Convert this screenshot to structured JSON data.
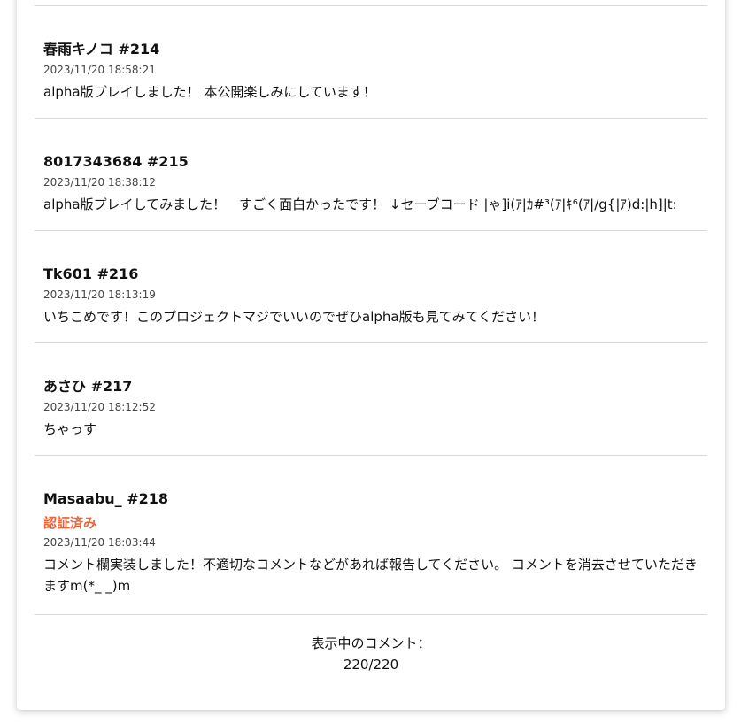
{
  "comments": [
    {
      "author": "春雨キノコ #214",
      "date": "2023/11/20 18:58:21",
      "body": "alpha版プレイしました！ 本公開楽しみにしています！"
    },
    {
      "author": "8017343684 #215",
      "date": "2023/11/20 18:38:12",
      "body": "alpha版プレイしてみました！　すごく面白かったです！ ↓セーブコード |ゃ]i(ｱ|ｶ#³(ｱ|ｷ⁶(ｱ|/g{|ｱ)d:|h]|t:"
    },
    {
      "author": "Tk601 #216",
      "date": "2023/11/20 18:13:19",
      "body": "いちこめです！このプロジェクトマジでいいのでぜひalpha版も見てみてください！"
    },
    {
      "author": "あさひ #217",
      "date": "2023/11/20 18:12:52",
      "body": "ちゃっす"
    },
    {
      "author": "Masaabu_ #218",
      "badge": "認証済み",
      "date": "2023/11/20 18:03:44",
      "body": "コメント欄実装しました！不適切なコメントなどがあれば報告してください。 コメントを消去させていただきますm(*_ _)m"
    }
  ],
  "footer": {
    "label": "表示中のコメント：",
    "count": "220/220"
  },
  "colors": {
    "badge": "#e8663a",
    "divider": "#d9d9d9"
  }
}
